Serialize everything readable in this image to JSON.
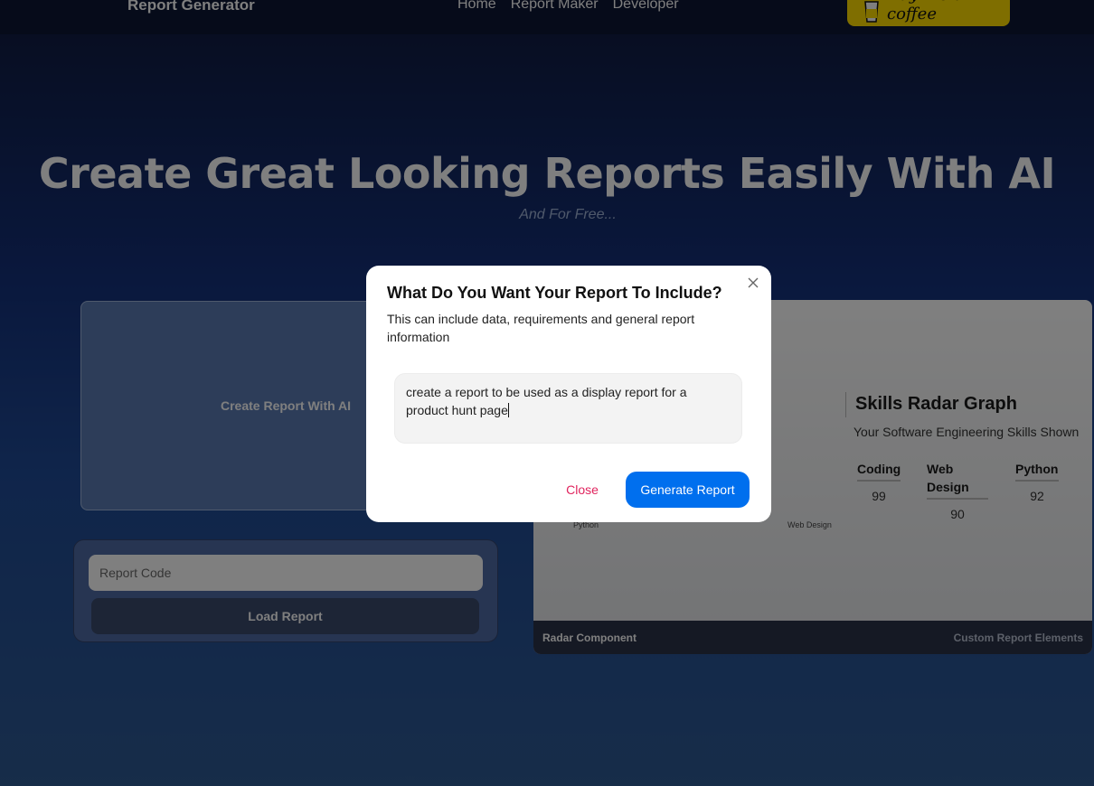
{
  "nav": {
    "brand": "Report Generator",
    "links": [
      "Home",
      "Report Maker",
      "Developer"
    ],
    "coffee_label": "Buy me a coffee"
  },
  "hero": {
    "title": "Create Great Looking Reports Easily With AI",
    "subtitle": "And For Free..."
  },
  "create_card": {
    "label": "Create Report With AI"
  },
  "load_card": {
    "input_placeholder": "Report Code",
    "button_label": "Load Report"
  },
  "preview": {
    "title": "Skills Radar Graph",
    "subtitle": "Your Software Engineering Skills Shown",
    "skills": [
      {
        "name": "Coding",
        "value": "99"
      },
      {
        "name": "Web Design",
        "value": "90"
      },
      {
        "name": "Python",
        "value": "92"
      }
    ],
    "axis_labels": [
      "Python",
      "Web Design"
    ],
    "footer_left": "Radar Component",
    "footer_right": "Custom Report Elements"
  },
  "modal": {
    "title": "What Do You Want Your Report To Include?",
    "description": "This can include data, requirements and general report information",
    "textarea_value": "create a report to be used as a display report for a product hunt page",
    "cancel_label": "Close",
    "submit_label": "Generate Report"
  },
  "colors": {
    "primary": "#006fee",
    "danger": "#e0245e",
    "coffee": "#ffdd00"
  }
}
